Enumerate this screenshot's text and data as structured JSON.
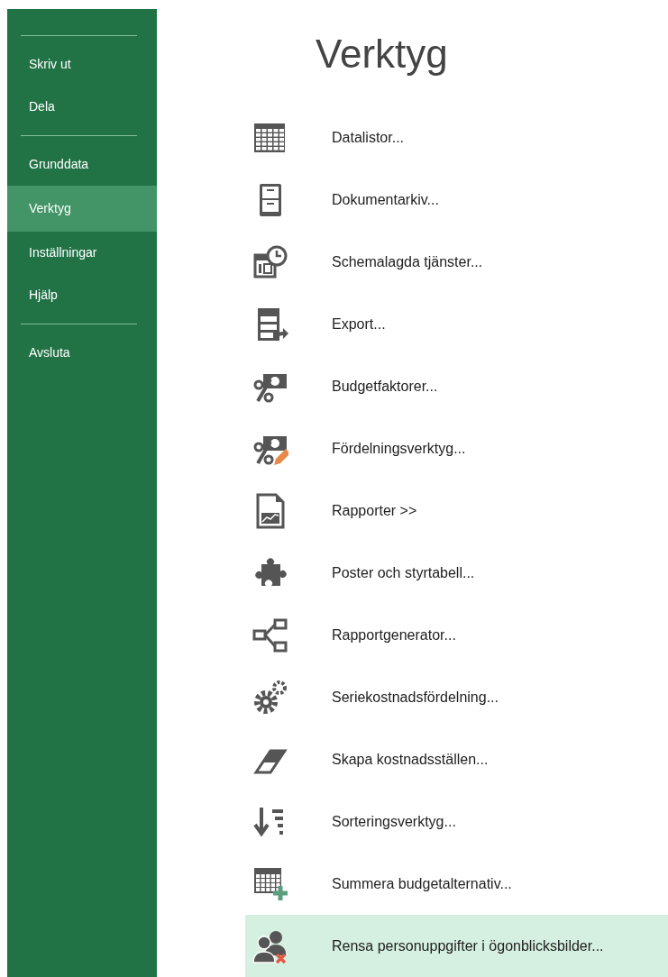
{
  "sidebar": {
    "items": [
      {
        "kind": "divider"
      },
      {
        "kind": "item",
        "label": "Skriv ut",
        "selected": false
      },
      {
        "kind": "item",
        "label": "Dela",
        "selected": false
      },
      {
        "kind": "divider"
      },
      {
        "kind": "item",
        "label": "Grunddata",
        "selected": false
      },
      {
        "kind": "item",
        "label": "Verktyg",
        "selected": true
      },
      {
        "kind": "item",
        "label": "Inställningar",
        "selected": false
      },
      {
        "kind": "item",
        "label": "Hjälp",
        "selected": false
      },
      {
        "kind": "divider"
      },
      {
        "kind": "item",
        "label": "Avsluta",
        "selected": false
      }
    ]
  },
  "title": "Verktyg",
  "tools": [
    {
      "label": "Datalistor...",
      "selected": false
    },
    {
      "label": "Dokumentarkiv...",
      "selected": false
    },
    {
      "label": "Schemalagda tjänster...",
      "selected": false
    },
    {
      "label": "Export...",
      "selected": false
    },
    {
      "label": "Budgetfaktorer...",
      "selected": false
    },
    {
      "label": "Fördelningsverktyg...",
      "selected": false
    },
    {
      "label": "Rapporter >>",
      "selected": false
    },
    {
      "label": "Poster och styrtabell...",
      "selected": false
    },
    {
      "label": "Rapportgenerator...",
      "selected": false
    },
    {
      "label": "Seriekostnadsfördelning...",
      "selected": false
    },
    {
      "label": "Skapa kostnadsställen...",
      "selected": false
    },
    {
      "label": "Sorteringsverktyg...",
      "selected": false
    },
    {
      "label": "Summera budgetalternativ...",
      "selected": false
    },
    {
      "label": "Rensa personuppgifter i ögonblicksbilder...",
      "selected": true
    }
  ]
}
